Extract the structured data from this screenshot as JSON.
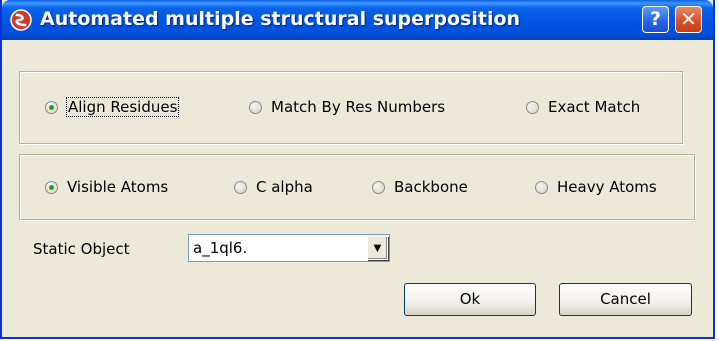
{
  "window": {
    "title": "Automated multiple structural superposition",
    "help_label": "?",
    "close_label": "✕",
    "icon": "app-logo-icon"
  },
  "match_options": {
    "selected": "align_residues",
    "items": [
      {
        "id": "align_residues",
        "label": "Align Residues"
      },
      {
        "id": "match_by_res_numbers",
        "label": "Match By Res Numbers"
      },
      {
        "id": "exact_match",
        "label": "Exact Match"
      }
    ]
  },
  "atom_options": {
    "selected": "visible_atoms",
    "items": [
      {
        "id": "visible_atoms",
        "label": "Visible Atoms"
      },
      {
        "id": "c_alpha",
        "label": "C alpha"
      },
      {
        "id": "backbone",
        "label": "Backbone"
      },
      {
        "id": "heavy_atoms",
        "label": "Heavy Atoms"
      }
    ]
  },
  "static_object": {
    "label": "Static Object",
    "value": "a_1ql6."
  },
  "buttons": {
    "ok": "Ok",
    "cancel": "Cancel"
  },
  "colors": {
    "titlebar": "#0054e3",
    "dialog_bg": "#ece9d8",
    "radio_selected": "#21a121",
    "close_button": "#d9522c"
  }
}
